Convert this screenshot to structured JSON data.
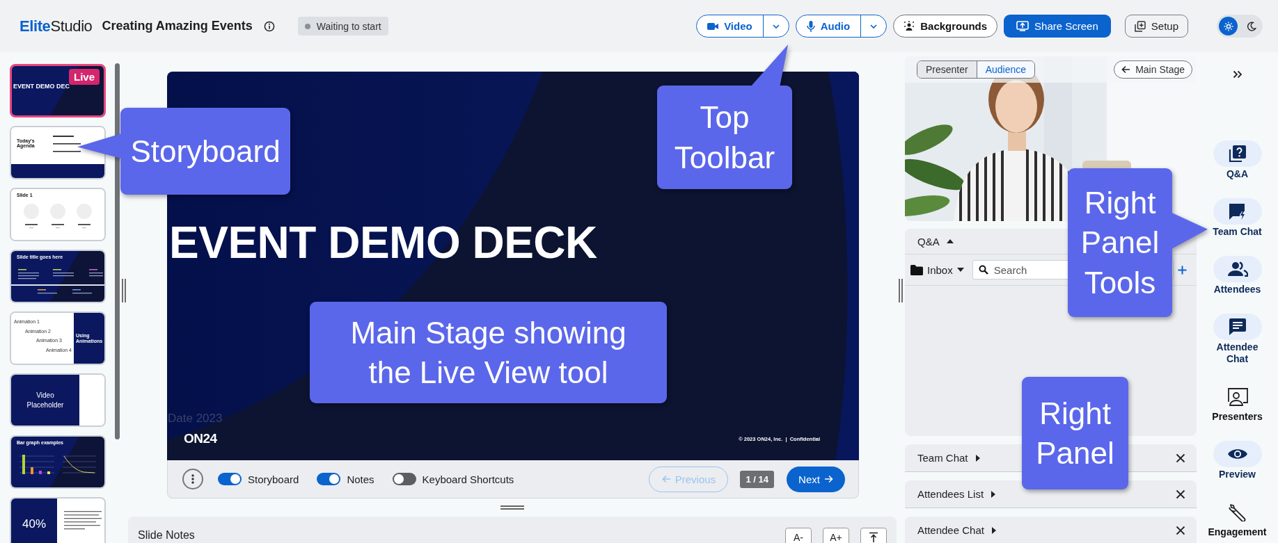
{
  "app": {
    "logo_brand": "Elite",
    "logo_product": "Studio",
    "event_title": "Creating Amazing Events",
    "status": "Waiting to start"
  },
  "toolbar": [
    {
      "kind": "split",
      "label": "Video"
    },
    {
      "kind": "split",
      "label": "Audio"
    },
    {
      "kind": "outline",
      "label": "Backgrounds"
    },
    {
      "kind": "primary",
      "label": "Share Screen"
    },
    {
      "kind": "plain",
      "label": "Setup"
    }
  ],
  "theme_modes": [
    {
      "selected": true
    },
    {
      "selected": false
    }
  ],
  "storyboard": {
    "slides": [
      {
        "kind": "title",
        "title": "EVENT DEMO DEC",
        "badge": "Live",
        "selected": true
      },
      {
        "kind": "agenda",
        "title": "Today's Agenda",
        "selected": false
      },
      {
        "kind": "speakers",
        "title": "Slide 1",
        "selected": false
      },
      {
        "kind": "columns",
        "title": "Slide title goes here",
        "selected": false
      },
      {
        "kind": "animation",
        "lines": [
          "Animation 1",
          "Animation 2",
          "Animation 3",
          "Animation 4"
        ],
        "title": "Using Animations",
        "selected": false
      },
      {
        "kind": "video",
        "title": "Video Placeholder",
        "selected": false
      },
      {
        "kind": "chart",
        "title": "Bar graph examples",
        "selected": false
      },
      {
        "kind": "stat",
        "title": "40%",
        "selected": false
      }
    ]
  },
  "stage": {
    "slide": {
      "title": "EVENT DEMO DECK",
      "date": "Date 2023",
      "logo": "ON24",
      "footer": "© 2023 ON24, Inc.  |  Confidential"
    },
    "controls": {
      "toggles": [
        {
          "label": "Storyboard",
          "on": true
        },
        {
          "label": "Notes",
          "on": true
        },
        {
          "label": "Keyboard Shortcuts",
          "on": false
        }
      ],
      "previous": {
        "label": "Previous",
        "disabled": true
      },
      "page": "1 / 14",
      "next": "Next"
    }
  },
  "notes": {
    "title": "Slide Notes",
    "buttons": [
      "A-",
      "A+"
    ]
  },
  "right_panel": {
    "view_tabs": [
      {
        "label": "Presenter",
        "selected": false
      },
      {
        "label": "Audience",
        "selected": true
      }
    ],
    "back_button": "Main Stage",
    "qa": {
      "title": "Q&A",
      "folder": "Inbox",
      "search": {
        "placeholder": "Search"
      }
    },
    "sections": [
      {
        "title": "Team Chat"
      },
      {
        "title": "Attendees List"
      },
      {
        "title": "Attendee Chat"
      }
    ]
  },
  "tools": [
    {
      "label": "Q&A",
      "highlighted": true
    },
    {
      "label": "Team Chat",
      "highlighted": true
    },
    {
      "label": "Attendees",
      "highlighted": true
    },
    {
      "label": "Attendee Chat",
      "highlighted": true
    },
    {
      "label": "Presenters",
      "highlighted": false
    },
    {
      "label": "Preview",
      "highlighted": true
    },
    {
      "label": "Engagement",
      "highlighted": false
    }
  ],
  "annotations": [
    {
      "text": "Storyboard",
      "kind": "left"
    },
    {
      "text": "Top Toolbar",
      "kind": "up"
    },
    {
      "text": "Main Stage showing the Live View tool",
      "kind": "plain"
    },
    {
      "text": "Right Panel Tools",
      "kind": "right"
    },
    {
      "text": "Right Panel",
      "kind": "plain"
    }
  ]
}
